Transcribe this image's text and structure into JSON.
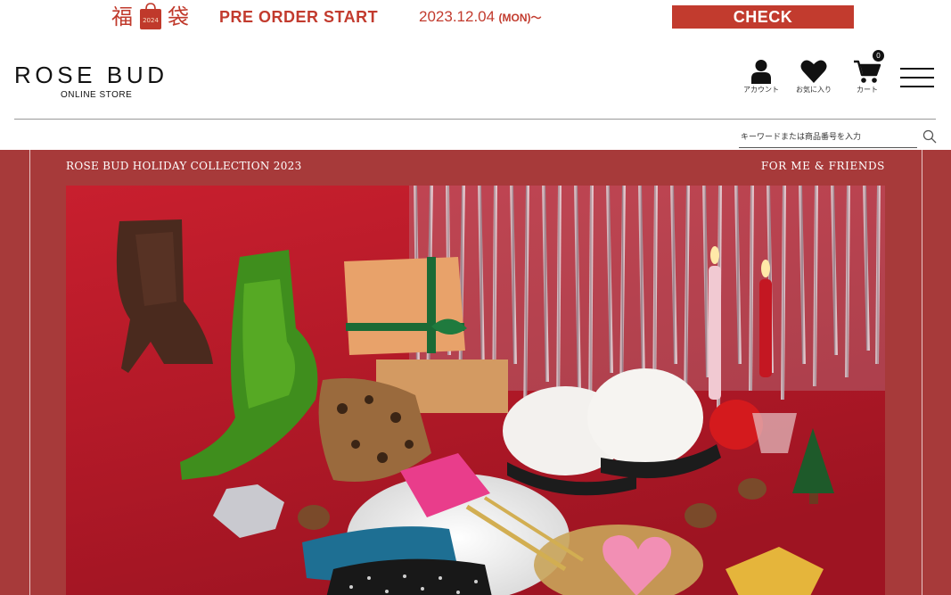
{
  "promo": {
    "kanji_1": "福",
    "kanji_2": "袋",
    "bag_year": "2024",
    "title": "PRE ORDER START",
    "date": "2023.12.04",
    "weekday": "(MON)～",
    "check_label": "CHECK"
  },
  "header": {
    "logo_main": "ROSE BUD",
    "logo_sub": "ONLINE STORE",
    "account_label": "アカウント",
    "favorites_label": "お気に入り",
    "cart_label": "カート",
    "cart_count": "0"
  },
  "search": {
    "placeholder": "キーワードまたは商品番号を入力"
  },
  "hero": {
    "title": "ROSE BUD HOLIDAY COLLECTION 2023",
    "subtitle": "FOR ME & FRIENDS"
  },
  "colors": {
    "accent": "#c23b2e",
    "hero_bg": "#a73a3a",
    "photo_bg": "#b81b2a"
  }
}
